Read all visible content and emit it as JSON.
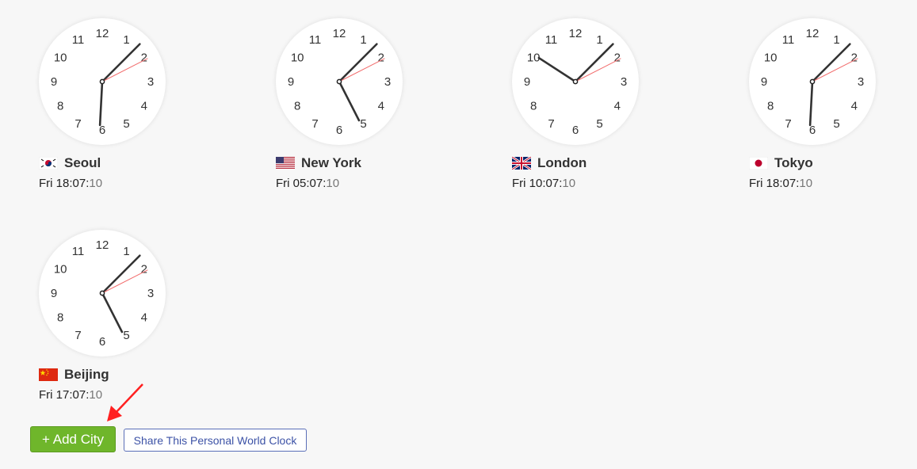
{
  "clocks": [
    {
      "city": "Seoul",
      "flag": "south-korea",
      "day": "Fri",
      "time_hm": "18:07:",
      "time_s": "10",
      "hands": {
        "hour": 183,
        "minute": 45,
        "second": 63
      }
    },
    {
      "city": "New York",
      "flag": "usa",
      "day": "Fri",
      "time_hm": "05:07:",
      "time_s": "10",
      "hands": {
        "hour": 153,
        "minute": 45,
        "second": 63
      }
    },
    {
      "city": "London",
      "flag": "uk",
      "day": "Fri",
      "time_hm": "10:07:",
      "time_s": "10",
      "hands": {
        "hour": 303,
        "minute": 45,
        "second": 63
      }
    },
    {
      "city": "Tokyo",
      "flag": "japan",
      "day": "Fri",
      "time_hm": "18:07:",
      "time_s": "10",
      "hands": {
        "hour": 183,
        "minute": 45,
        "second": 63
      }
    },
    {
      "city": "Beijing",
      "flag": "china",
      "day": "Fri",
      "time_hm": "17:07:",
      "time_s": "10",
      "hands": {
        "hour": 153,
        "minute": 45,
        "second": 63
      }
    }
  ],
  "dial_numbers": [
    "12",
    "1",
    "2",
    "3",
    "4",
    "5",
    "6",
    "7",
    "8",
    "9",
    "10",
    "11"
  ],
  "actions": {
    "add_city_label": "+ Add City",
    "share_label": "Share This Personal World Clock"
  },
  "colors": {
    "background": "#f7f7f7",
    "second_hand": "#f26d6d",
    "hands": "#333333",
    "add_button": "#6fb62b",
    "share_border": "#5b6fb8",
    "arrow": "#ff2020"
  }
}
